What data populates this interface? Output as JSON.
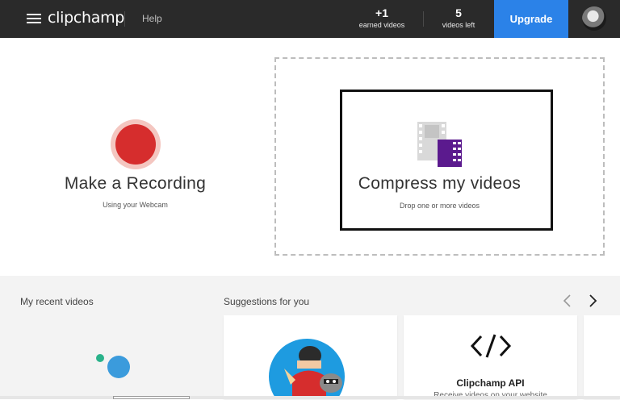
{
  "header": {
    "logo": "clipchamp",
    "help_label": "Help",
    "earned": {
      "value": "+1",
      "label": "earned videos"
    },
    "videos_left": {
      "value": "5",
      "label": "videos left"
    },
    "upgrade_label": "Upgrade"
  },
  "hero": {
    "record": {
      "title": "Make a Recording",
      "subtitle": "Using your Webcam"
    },
    "compress": {
      "title": "Compress my videos",
      "subtitle": "Drop one or more videos"
    }
  },
  "recent": {
    "title": "My recent videos"
  },
  "suggestions": {
    "title": "Suggestions for you",
    "cards": [
      {
        "title": "",
        "subtitle": ""
      },
      {
        "title": "Clipchamp API",
        "subtitle": "Receive videos on your website"
      }
    ]
  },
  "icons": {
    "menu": "menu-icon",
    "record": "record-icon",
    "film": "film-icon",
    "prev": "chevron-left-icon",
    "next": "chevron-right-icon",
    "code": "code-icon"
  },
  "colors": {
    "topbar": "#2a2a2a",
    "upgrade": "#2b82e8",
    "record": "#d62d2d",
    "film_accent": "#5b1a8e"
  }
}
